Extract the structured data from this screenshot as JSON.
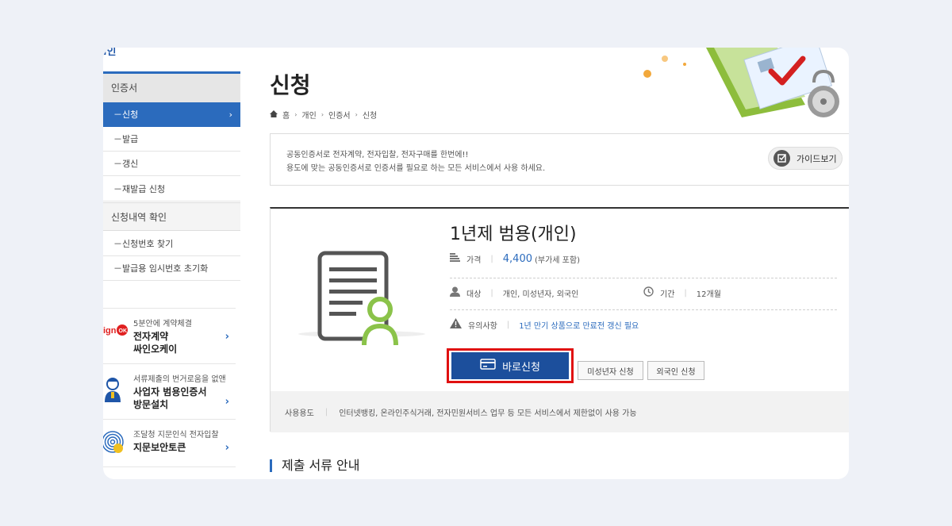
{
  "colors": {
    "accent": "#2b6bbd",
    "active": "#2b6bbd",
    "highlight": "#e01010",
    "button": "#1c4f9c"
  },
  "logo_fragment": "l인",
  "sidebar": {
    "category1": "인증서",
    "items1": [
      "－신청",
      "－발급",
      "－갱신",
      "－재발급 신청"
    ],
    "category2": "신청내역 확인",
    "items2": [
      "－신청번호 찾기",
      "－발급용 임시번호 초기화"
    ],
    "promos": [
      {
        "sub": "5분안에 계약체결",
        "title1": "전자계약",
        "title2": "싸인오케이",
        "icon": "signok-logo-icon"
      },
      {
        "sub": "서류제출의 번거로움을 없앤",
        "title1": "사업자 범용인증서",
        "title2": "방문설치",
        "icon": "person-icon"
      },
      {
        "sub": "조달청 지문인식 전자입찰",
        "title1": "지문보안토큰",
        "title2": "",
        "icon": "fingerprint-icon"
      }
    ]
  },
  "page": {
    "title": "신청",
    "breadcrumb": [
      "홈",
      "개인",
      "인증서",
      "신청"
    ]
  },
  "notice": {
    "line1": "공동인증서로 전자계약, 전자입찰, 전자구매를 한번에!!",
    "line2": "용도에 맞는 공동인증서로 인증서를 필요로 하는 모든 서비스에서 사용 하세요.",
    "guide_label": "가이드보기"
  },
  "product": {
    "name": "1년제 범용(개인)",
    "price_label": "가격",
    "price": "4,400",
    "price_note": "(부가세 포함)",
    "target_label": "대상",
    "target": "개인, 미성년자, 외국인",
    "period_label": "기간",
    "period": "12개월",
    "caution_label": "유의사항",
    "caution": "1년 만기 상품으로 만료전 갱신 필요",
    "apply_label": "바로신청",
    "minor_label": "미성년자 신청",
    "foreigner_label": "외국인 신청",
    "usage_label": "사용용도",
    "usage": "인터넷뱅킹, 온라인주식거래, 전자민원서비스 업무 등 모든 서비스에서 제한없이 사용 가능"
  },
  "section": {
    "title": "제출 서류 안내"
  }
}
